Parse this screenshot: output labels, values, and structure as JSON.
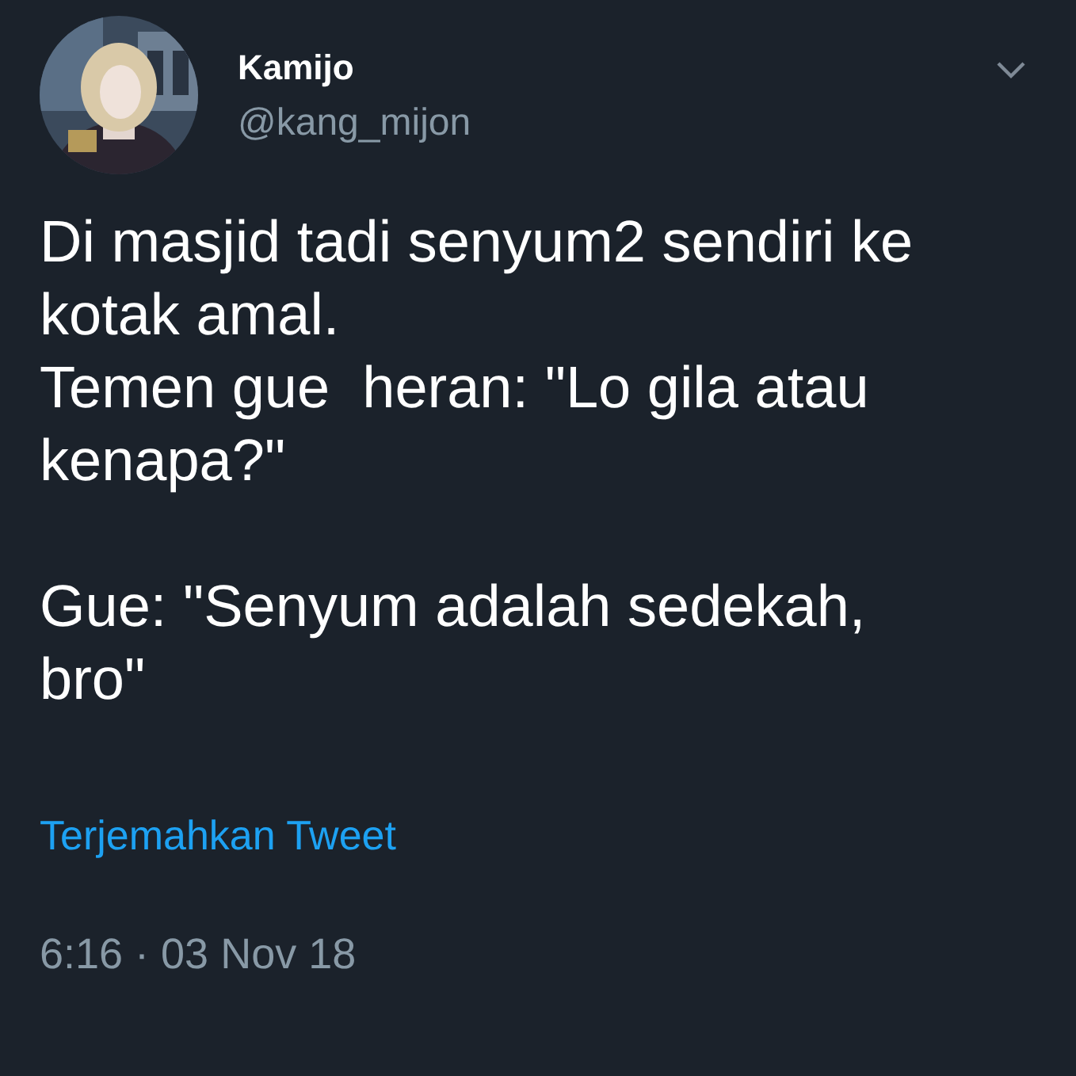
{
  "author": {
    "name": "Kamijo",
    "handle": "@kang_mijon"
  },
  "tweet": {
    "text": "Di masjid tadi senyum2 sendiri ke\nkotak amal.\nTemen gue  heran: \"Lo gila atau\nkenapa?\"\n\nGue: \"Senyum adalah sedekah,\nbro\""
  },
  "translate_link": "Terjemahkan Tweet",
  "timestamp": "6:16 · 03 Nov 18"
}
